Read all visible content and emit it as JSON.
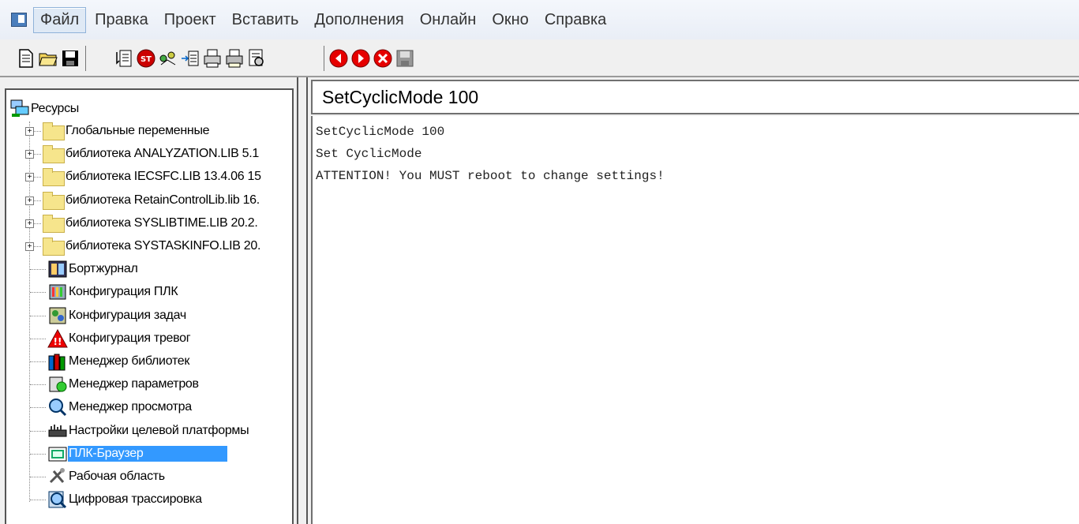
{
  "menubar": {
    "items": [
      "Файл",
      "Правка",
      "Проект",
      "Вставить",
      "Дополнения",
      "Онлайн",
      "Окно",
      "Справка"
    ],
    "active_index": 0
  },
  "toolbar": {
    "group1": [
      "new-file-icon",
      "open-folder-icon",
      "save-icon"
    ],
    "group2": [
      "build-icon",
      "st-icon",
      "login-icon",
      "transfer-icon",
      "printer-icon",
      "print-preview-icon",
      "inspect-icon"
    ],
    "group3": [
      "nav-back-icon",
      "nav-forward-icon",
      "cancel-icon",
      "save-disabled-icon"
    ]
  },
  "tree": {
    "root": "Ресурсы",
    "items": [
      {
        "label": "Глобальные переменные",
        "type": "folder",
        "expandable": true
      },
      {
        "label": "библиотека ANALYZATION.LIB 5.1",
        "type": "folder",
        "expandable": true
      },
      {
        "label": "библиотека IECSFC.LIB 13.4.06 15",
        "type": "folder",
        "expandable": true
      },
      {
        "label": "библиотека RetainControlLib.lib 16.",
        "type": "folder",
        "expandable": true
      },
      {
        "label": "библиотека SYSLIBTIME.LIB 20.2.",
        "type": "folder",
        "expandable": true
      },
      {
        "label": "библиотека SYSTASKINFO.LIB 20.",
        "type": "folder",
        "expandable": true
      },
      {
        "label": "Бортжурнал",
        "type": "logbook",
        "expandable": false
      },
      {
        "label": "Конфигурация ПЛК",
        "type": "plc-config",
        "expandable": false
      },
      {
        "label": "Конфигурация задач",
        "type": "task-config",
        "expandable": false
      },
      {
        "label": "Конфигурация тревог",
        "type": "alarm-config",
        "expandable": false
      },
      {
        "label": "Менеджер библиотек",
        "type": "library-manager",
        "expandable": false
      },
      {
        "label": "Менеджер параметров",
        "type": "parameter-manager",
        "expandable": false
      },
      {
        "label": "Менеджер просмотра",
        "type": "watch-manager",
        "expandable": false
      },
      {
        "label": "Настройки целевой платформы",
        "type": "target-settings",
        "expandable": false
      },
      {
        "label": "ПЛК-Браузер",
        "type": "plc-browser",
        "expandable": false,
        "selected": true
      },
      {
        "label": "Рабочая область",
        "type": "workspace",
        "expandable": false
      },
      {
        "label": "Цифровая трассировка",
        "type": "trace",
        "expandable": false
      }
    ]
  },
  "command": {
    "value": "SetCyclicMode 100"
  },
  "output": {
    "lines": [
      "SetCyclicMode 100",
      "Set CyclicMode",
      "ATTENTION! You MUST reboot to change settings!"
    ]
  },
  "colors": {
    "selection": "#3399ff",
    "folder": "#f6e58c"
  }
}
